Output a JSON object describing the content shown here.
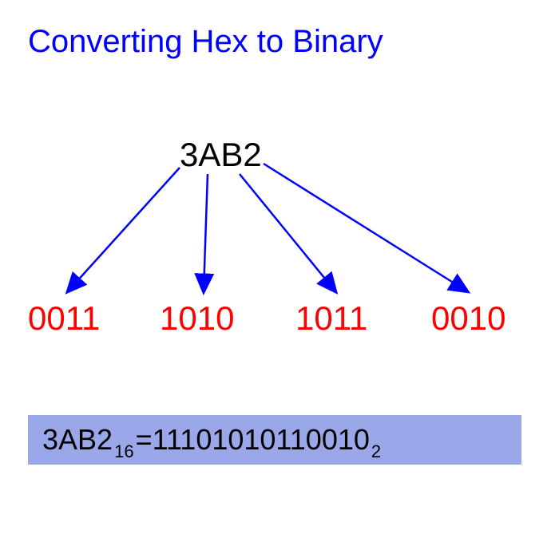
{
  "title": "Converting Hex to Binary",
  "hexValue": "3AB2",
  "binaryGroups": [
    "0011",
    "1010",
    "1011",
    "0010"
  ],
  "result": {
    "hex": "3AB2",
    "hexBase": "16",
    "equals": " = ",
    "binary": "11101010110010",
    "binaryBase": "2"
  },
  "colors": {
    "title": "#0000ff",
    "arrows": "#0000ff",
    "binary": "#ff0000",
    "boxBg": "#9aa8ea"
  }
}
